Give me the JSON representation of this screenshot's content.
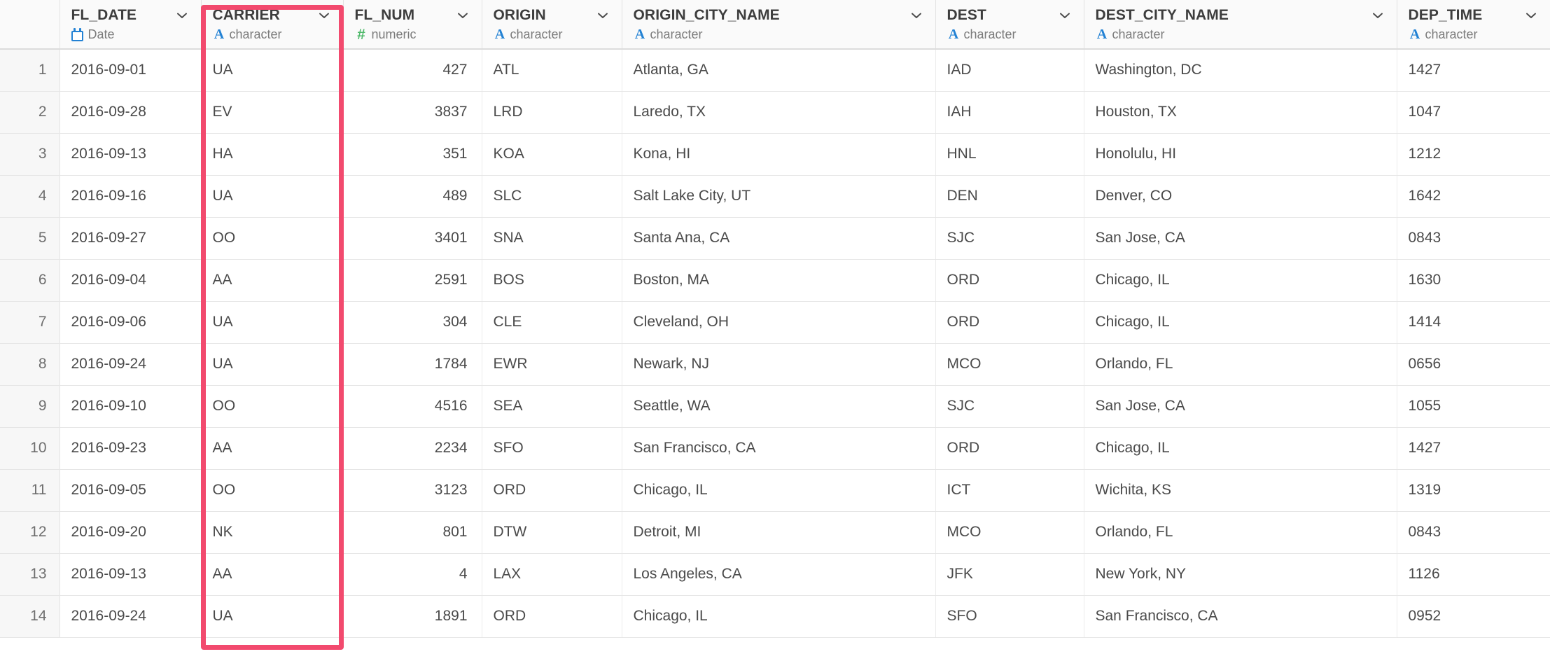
{
  "table": {
    "rownum_header": "",
    "columns": [
      {
        "name": "FL_DATE",
        "type_label": "Date",
        "type_icon": "calendar-icon",
        "align": "left"
      },
      {
        "name": "CARRIER",
        "type_label": "character",
        "type_icon": "character-icon",
        "align": "left"
      },
      {
        "name": "FL_NUM",
        "type_label": "numeric",
        "type_icon": "numeric-icon",
        "align": "right"
      },
      {
        "name": "ORIGIN",
        "type_label": "character",
        "type_icon": "character-icon",
        "align": "left"
      },
      {
        "name": "ORIGIN_CITY_NAME",
        "type_label": "character",
        "type_icon": "character-icon",
        "align": "left"
      },
      {
        "name": "DEST",
        "type_label": "character",
        "type_icon": "character-icon",
        "align": "left"
      },
      {
        "name": "DEST_CITY_NAME",
        "type_label": "character",
        "type_icon": "character-icon",
        "align": "left"
      },
      {
        "name": "DEP_TIME",
        "type_label": "character",
        "type_icon": "character-icon",
        "align": "left"
      }
    ],
    "rows": [
      {
        "n": "1",
        "FL_DATE": "2016-09-01",
        "CARRIER": "UA",
        "FL_NUM": "427",
        "ORIGIN": "ATL",
        "ORIGIN_CITY_NAME": "Atlanta, GA",
        "DEST": "IAD",
        "DEST_CITY_NAME": "Washington, DC",
        "DEP_TIME": "1427"
      },
      {
        "n": "2",
        "FL_DATE": "2016-09-28",
        "CARRIER": "EV",
        "FL_NUM": "3837",
        "ORIGIN": "LRD",
        "ORIGIN_CITY_NAME": "Laredo, TX",
        "DEST": "IAH",
        "DEST_CITY_NAME": "Houston, TX",
        "DEP_TIME": "1047"
      },
      {
        "n": "3",
        "FL_DATE": "2016-09-13",
        "CARRIER": "HA",
        "FL_NUM": "351",
        "ORIGIN": "KOA",
        "ORIGIN_CITY_NAME": "Kona, HI",
        "DEST": "HNL",
        "DEST_CITY_NAME": "Honolulu, HI",
        "DEP_TIME": "1212"
      },
      {
        "n": "4",
        "FL_DATE": "2016-09-16",
        "CARRIER": "UA",
        "FL_NUM": "489",
        "ORIGIN": "SLC",
        "ORIGIN_CITY_NAME": "Salt Lake City, UT",
        "DEST": "DEN",
        "DEST_CITY_NAME": "Denver, CO",
        "DEP_TIME": "1642"
      },
      {
        "n": "5",
        "FL_DATE": "2016-09-27",
        "CARRIER": "OO",
        "FL_NUM": "3401",
        "ORIGIN": "SNA",
        "ORIGIN_CITY_NAME": "Santa Ana, CA",
        "DEST": "SJC",
        "DEST_CITY_NAME": "San Jose, CA",
        "DEP_TIME": "0843"
      },
      {
        "n": "6",
        "FL_DATE": "2016-09-04",
        "CARRIER": "AA",
        "FL_NUM": "2591",
        "ORIGIN": "BOS",
        "ORIGIN_CITY_NAME": "Boston, MA",
        "DEST": "ORD",
        "DEST_CITY_NAME": "Chicago, IL",
        "DEP_TIME": "1630"
      },
      {
        "n": "7",
        "FL_DATE": "2016-09-06",
        "CARRIER": "UA",
        "FL_NUM": "304",
        "ORIGIN": "CLE",
        "ORIGIN_CITY_NAME": "Cleveland, OH",
        "DEST": "ORD",
        "DEST_CITY_NAME": "Chicago, IL",
        "DEP_TIME": "1414"
      },
      {
        "n": "8",
        "FL_DATE": "2016-09-24",
        "CARRIER": "UA",
        "FL_NUM": "1784",
        "ORIGIN": "EWR",
        "ORIGIN_CITY_NAME": "Newark, NJ",
        "DEST": "MCO",
        "DEST_CITY_NAME": "Orlando, FL",
        "DEP_TIME": "0656"
      },
      {
        "n": "9",
        "FL_DATE": "2016-09-10",
        "CARRIER": "OO",
        "FL_NUM": "4516",
        "ORIGIN": "SEA",
        "ORIGIN_CITY_NAME": "Seattle, WA",
        "DEST": "SJC",
        "DEST_CITY_NAME": "San Jose, CA",
        "DEP_TIME": "1055"
      },
      {
        "n": "10",
        "FL_DATE": "2016-09-23",
        "CARRIER": "AA",
        "FL_NUM": "2234",
        "ORIGIN": "SFO",
        "ORIGIN_CITY_NAME": "San Francisco, CA",
        "DEST": "ORD",
        "DEST_CITY_NAME": "Chicago, IL",
        "DEP_TIME": "1427"
      },
      {
        "n": "11",
        "FL_DATE": "2016-09-05",
        "CARRIER": "OO",
        "FL_NUM": "3123",
        "ORIGIN": "ORD",
        "ORIGIN_CITY_NAME": "Chicago, IL",
        "DEST": "ICT",
        "DEST_CITY_NAME": "Wichita, KS",
        "DEP_TIME": "1319"
      },
      {
        "n": "12",
        "FL_DATE": "2016-09-20",
        "CARRIER": "NK",
        "FL_NUM": "801",
        "ORIGIN": "DTW",
        "ORIGIN_CITY_NAME": "Detroit, MI",
        "DEST": "MCO",
        "DEST_CITY_NAME": "Orlando, FL",
        "DEP_TIME": "0843"
      },
      {
        "n": "13",
        "FL_DATE": "2016-09-13",
        "CARRIER": "AA",
        "FL_NUM": "4",
        "ORIGIN": "LAX",
        "ORIGIN_CITY_NAME": "Los Angeles, CA",
        "DEST": "JFK",
        "DEST_CITY_NAME": "New York, NY",
        "DEP_TIME": "1126"
      },
      {
        "n": "14",
        "FL_DATE": "2016-09-24",
        "CARRIER": "UA",
        "FL_NUM": "1891",
        "ORIGIN": "ORD",
        "ORIGIN_CITY_NAME": "Chicago, IL",
        "DEST": "SFO",
        "DEST_CITY_NAME": "San Francisco, CA",
        "DEP_TIME": "0952"
      }
    ]
  },
  "highlight": {
    "target_column": "CARRIER",
    "color": "#f24a6e"
  }
}
